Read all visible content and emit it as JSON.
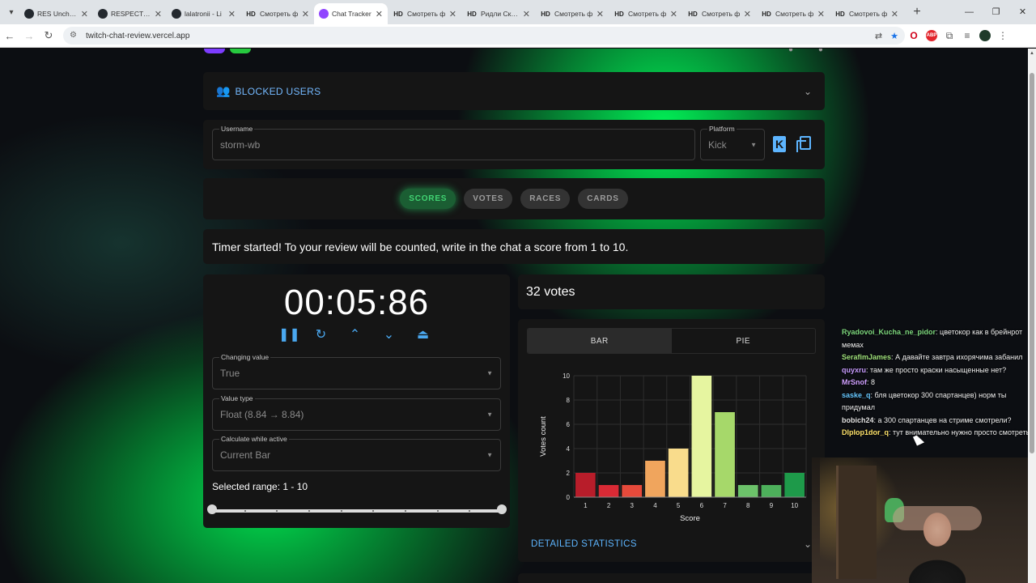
{
  "browser": {
    "tabs": [
      {
        "favicon": "github-icon",
        "title": "RES Unchain",
        "active": false
      },
      {
        "favicon": "github-icon",
        "title": "RESPECT - Li",
        "active": false
      },
      {
        "favicon": "github-icon",
        "title": "lalatronii - Li",
        "active": false
      },
      {
        "favicon": "hd-icon",
        "title": "Смотреть ф",
        "active": false
      },
      {
        "favicon": "chat-tracker-icon",
        "title": "Chat Tracker",
        "active": true
      },
      {
        "favicon": "hd-icon",
        "title": "Смотреть ф",
        "active": false
      },
      {
        "favicon": "hd-icon",
        "title": "Ридли Скотт",
        "active": false
      },
      {
        "favicon": "hd-icon",
        "title": "Смотреть ф",
        "active": false
      },
      {
        "favicon": "hd-icon",
        "title": "Смотреть ф",
        "active": false
      },
      {
        "favicon": "hd-icon",
        "title": "Смотреть ф",
        "active": false
      },
      {
        "favicon": "hd-icon",
        "title": "Смотреть ф",
        "active": false
      },
      {
        "favicon": "hd-icon",
        "title": "Смотреть ф",
        "active": false
      }
    ],
    "hd_badge": "HD",
    "url": "twitch-chat-review.vercel.app"
  },
  "blocked_users": {
    "label": "BLOCKED USERS"
  },
  "user_form": {
    "username_label": "Username",
    "username_value": "storm-wb",
    "platform_label": "Platform",
    "platform_value": "Kick",
    "kick_glyph": "K"
  },
  "mode_tabs": [
    {
      "label": "SCORES",
      "active": true
    },
    {
      "label": "VOTES",
      "active": false
    },
    {
      "label": "RACES",
      "active": false
    },
    {
      "label": "CARDS",
      "active": false
    }
  ],
  "message": "Timer started! To your review will be counted, write in the chat a score from 1 to 10.",
  "timer": {
    "display": "00:05:86",
    "changing_value_label": "Changing value",
    "changing_value": "True",
    "value_type_label": "Value type",
    "value_type": "Float (8.84 → 8.84)",
    "calculate_label": "Calculate while active",
    "calculate_value": "Current Bar",
    "selected_range": "Selected range: 1 - 10",
    "range_min": 1,
    "range_max": 10
  },
  "votes_summary": "32 votes",
  "chart_tabs": {
    "bar": "BAR",
    "pie": "PIE",
    "active": "BAR"
  },
  "detail_label": "DETAILED STATISTICS",
  "chart_data": {
    "type": "bar",
    "categories": [
      "1",
      "2",
      "3",
      "4",
      "5",
      "6",
      "7",
      "8",
      "9",
      "10"
    ],
    "values": [
      2,
      1,
      1,
      3,
      4,
      10,
      7,
      1,
      1,
      2
    ],
    "colors": [
      "#b81d2a",
      "#d92a35",
      "#e64a3b",
      "#f0a55d",
      "#f9dc8c",
      "#e6f5a0",
      "#a6d86a",
      "#6cc26a",
      "#4db05b",
      "#1e9a4a"
    ],
    "xlabel": "Score",
    "ylabel": "Votes count",
    "ylim": [
      0,
      10
    ],
    "yticks": [
      0,
      2,
      4,
      6,
      8,
      10
    ],
    "grid": true
  },
  "chat": [
    {
      "user": "Ryadovoi_Kucha_ne_pidor",
      "color": "#7ed87e",
      "text": "цветокор как в брейнрот мемах"
    },
    {
      "user": "SerafimJames",
      "color": "#9fe07a",
      "text": "А давайте завтра ихорячима забанил"
    },
    {
      "user": "quyxru",
      "color": "#c89cff",
      "text": "там же просто краски насыщенные нет?"
    },
    {
      "user": "MrSnof",
      "color": "#d0a0ff",
      "text": "8"
    },
    {
      "user": "saske_q",
      "color": "#66c7ff",
      "text": "бля цветокор 300 спартанцев) норм ты придумал"
    },
    {
      "user": "bobich24",
      "color": "#e0e0e0",
      "text": "а 300 спартанцев на стриме смотрели?"
    },
    {
      "user": "Dlplop1dor_q",
      "color": "#ffe36b",
      "text": "тут внимательно нужно просто смотреть"
    }
  ],
  "icons": {
    "blocked": "people-icon",
    "pause": "pause-icon",
    "reset": "restart-icon",
    "up": "chevron-up-icon",
    "down": "chevron-down-icon",
    "eject": "eject-icon",
    "copy": "copy-icon"
  }
}
